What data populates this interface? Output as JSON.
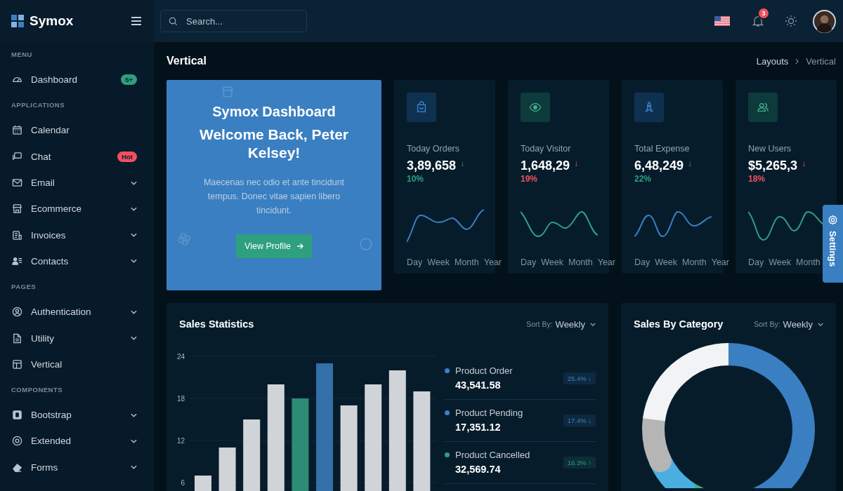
{
  "brand": {
    "name": "Symox"
  },
  "search": {
    "placeholder": "Search..."
  },
  "notifications": {
    "count": "3"
  },
  "sidebar": {
    "sections": [
      {
        "title": "MENU",
        "items": [
          {
            "label": "Dashboard",
            "badge": {
              "text": "5+",
              "color": "#2e9f7f"
            },
            "has_submenu": false
          }
        ]
      },
      {
        "title": "APPLICATIONS",
        "items": [
          {
            "label": "Calendar",
            "has_submenu": false
          },
          {
            "label": "Chat",
            "badge": {
              "text": "Hot",
              "color": "#f0505f"
            },
            "has_submenu": false
          },
          {
            "label": "Email",
            "has_submenu": true
          },
          {
            "label": "Ecommerce",
            "has_submenu": true
          },
          {
            "label": "Invoices",
            "has_submenu": true
          },
          {
            "label": "Contacts",
            "has_submenu": true
          }
        ]
      },
      {
        "title": "PAGES",
        "items": [
          {
            "label": "Authentication",
            "has_submenu": true
          },
          {
            "label": "Utility",
            "has_submenu": true
          },
          {
            "label": "Vertical",
            "has_submenu": false
          }
        ]
      },
      {
        "title": "COMPONENTS",
        "items": [
          {
            "label": "Bootstrap",
            "has_submenu": true
          },
          {
            "label": "Extended",
            "has_submenu": true
          },
          {
            "label": "Forms",
            "has_submenu": true
          }
        ]
      }
    ]
  },
  "page": {
    "title": "Vertical",
    "breadcrumb": [
      {
        "label": "Layouts",
        "selected": false
      },
      {
        "label": "Vertical",
        "selected": true
      }
    ]
  },
  "welcome": {
    "title": "Symox Dashboard",
    "greeting": "Welcome Back, Peter Kelsey!",
    "text": "Maecenas nec odio et ante tincidunt tempus. Donec vitae sapien libero tincidunt.",
    "button": "View Profile"
  },
  "stats": [
    {
      "label": "Today Orders",
      "value": "3,89,658",
      "arrow": "↓",
      "change": "10%",
      "color": "#2e9f7f",
      "periods": [
        "Day",
        "Week",
        "Month",
        "Year"
      ]
    },
    {
      "label": "Today Visitor",
      "value": "1,648,29",
      "arrow": "↓",
      "change": "19%",
      "color": "#f0505f",
      "periods": [
        "Day",
        "Week",
        "Month",
        "Year"
      ]
    },
    {
      "label": "Total Expense",
      "value": "6,48,249",
      "arrow": "↓",
      "change": "22%",
      "color": "#2e9f7f",
      "periods": [
        "Day",
        "Week",
        "Month",
        "Year"
      ]
    },
    {
      "label": "New Users",
      "value": "$5,265,3",
      "arrow": "↓",
      "change": "18%",
      "color": "#f0505f",
      "periods": [
        "Day",
        "Week",
        "Month"
      ]
    }
  ],
  "sales_statistics": {
    "title": "Sales Statistics",
    "sort_label": "Sort By:",
    "sort_value": "Weekly",
    "chart_data": {
      "type": "bar",
      "grid": true,
      "ylim": [
        0,
        24
      ],
      "yticks": [
        6,
        12,
        18,
        24
      ],
      "series": [
        {
          "color": "#d0d4d8",
          "values": [
            7,
            11,
            15,
            20,
            null,
            null,
            17,
            20,
            22,
            19
          ]
        },
        {
          "color": "#2e8b74",
          "values": [
            null,
            null,
            null,
            null,
            18,
            null,
            null,
            null,
            null,
            null
          ]
        },
        {
          "color": "#336fa8",
          "values": [
            null,
            null,
            null,
            null,
            null,
            23,
            null,
            null,
            null,
            null
          ]
        }
      ]
    },
    "legend": [
      {
        "name": "Product Order",
        "value": "43,541.58",
        "change": "25.4%",
        "arrow": "↓",
        "color": "#3b82c4"
      },
      {
        "name": "Product Pending",
        "value": "17,351.12",
        "change": "17.4%",
        "arrow": "↓",
        "color": "#3b82c4"
      },
      {
        "name": "Product Cancelled",
        "value": "32,569.74",
        "change": "16.3%",
        "arrow": "↑",
        "color": "#2e9f7f"
      }
    ]
  },
  "sales_by_category": {
    "title": "Sales By Category",
    "sort_label": "Sort By:",
    "sort_value": "Weekly"
  },
  "settings_tab": {
    "label": "Settings"
  }
}
